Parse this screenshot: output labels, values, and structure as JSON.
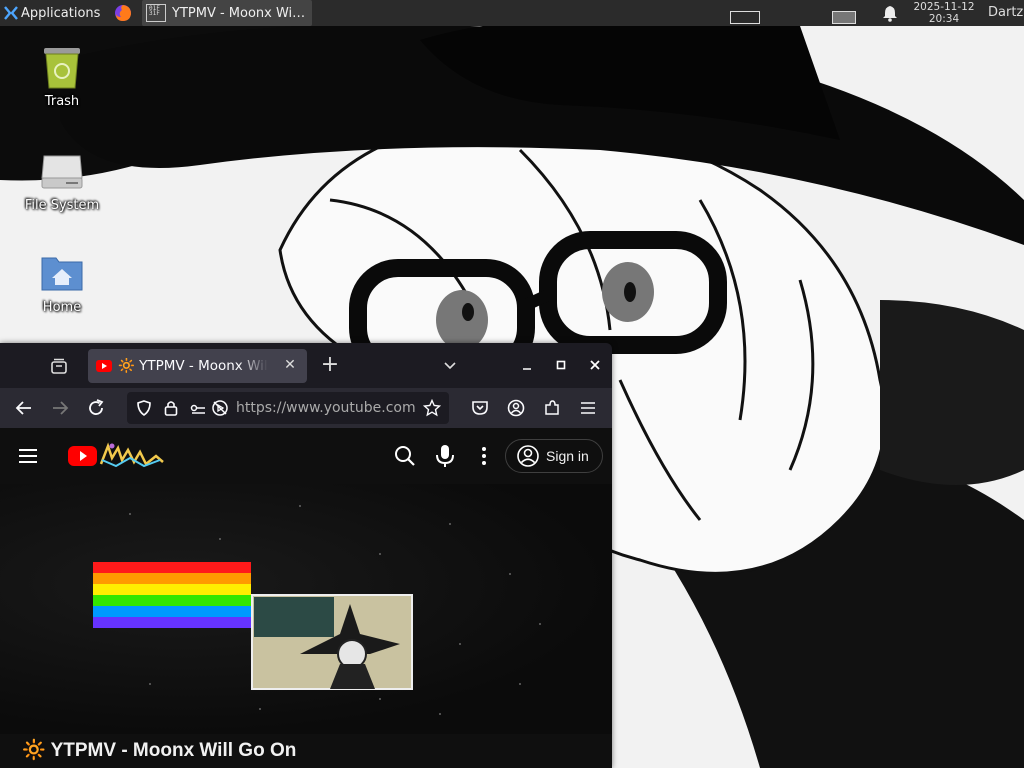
{
  "panel": {
    "applications_label": "Applications",
    "task_title": "YTPMV - Moonx Wil...",
    "terminal_icon_text": "01F\n31F",
    "clock_date": "2025-11-12",
    "clock_time": "20:34",
    "user_name": "Dartz"
  },
  "desktop": {
    "icons": [
      {
        "label": "Trash"
      },
      {
        "label": "File System"
      },
      {
        "label": "Home"
      }
    ]
  },
  "browser": {
    "tab_title": "🔆 YTPMV - Moonx Will Go On",
    "url": "https://www.youtube.com",
    "accent": "#ff0000"
  },
  "youtube": {
    "signin_label": "Sign in",
    "video_title": "🔆 YTPMV - Moonx Will Go On"
  }
}
